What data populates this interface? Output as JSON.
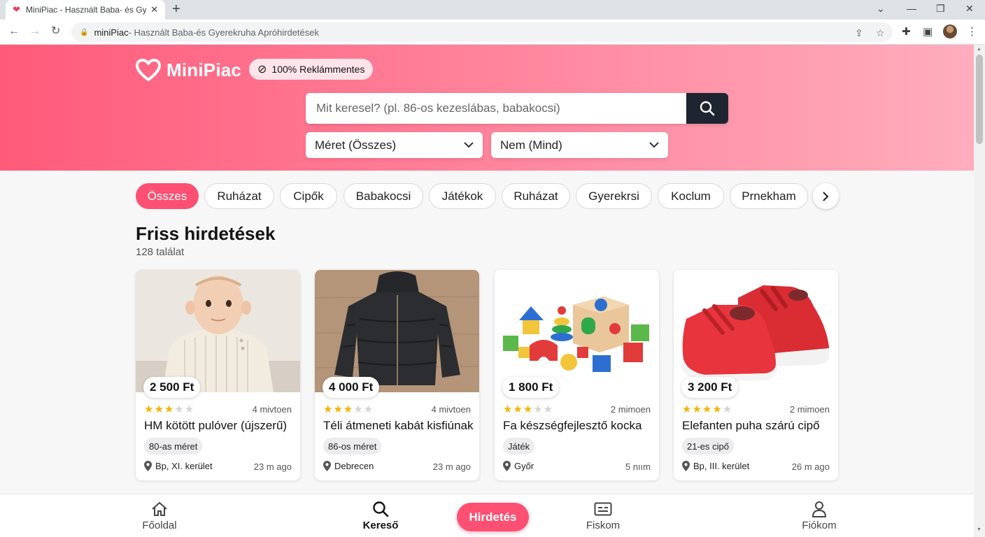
{
  "browser": {
    "tab_title": "MiniPiac - Használt Baba- és Gye",
    "url_host": "miniPiac",
    "url_rest": " - Használt Baba-és Gyerekruha Apróhirdetések"
  },
  "header": {
    "logo": "MiniPiac",
    "badge": "100% Reklámmentes",
    "search_placeholder": "Mit keresel? (pl. 86-os kezeslábas, babakocsi)",
    "size_select": "Méret (Összes)",
    "gender_select": "Nem (Mind)"
  },
  "categories": [
    "Összes",
    "Ruházat",
    "Cipők",
    "Babakocsi",
    "Játékok",
    "Ruházat",
    "Gyerekrsi",
    "Koclum",
    "Prnekham"
  ],
  "listing_section": {
    "title": "Friss hirdetések",
    "count": "128 találat"
  },
  "listings": [
    {
      "price": "2 500 Ft",
      "rating": 3,
      "posted": "4 mivtoen",
      "title": "HM kötött pulóver (újszerű)",
      "tag": "80-as méret",
      "location": "Bp, XI. kerület",
      "ago": "23 m ago",
      "image": "sweater-photo"
    },
    {
      "price": "4 000 Ft",
      "rating": 3,
      "posted": "4 mivtoen",
      "title": "Téli átmeneti kabát kisfiúnak",
      "tag": "86-os méret",
      "location": "Debrecen",
      "ago": "23 m ago",
      "image": "jacket-photo"
    },
    {
      "price": "1 800 Ft",
      "rating": 3,
      "posted": "2 mimoen",
      "title": "Fa készségfejlesztő kocka",
      "tag": "Játék",
      "location": "Győr",
      "ago": "5 nıım",
      "image": "toys-photo"
    },
    {
      "price": "3 200 Ft",
      "rating": 4,
      "posted": "2 mimoen",
      "title": "Elefanten puha szárú cipő",
      "tag": "21-es cipő",
      "location": "Bp, III. kerület",
      "ago": "26 m ago",
      "image": "shoes-photo"
    }
  ],
  "bottom_nav": {
    "home": "Főoldal",
    "search": "Kereső",
    "post": "Hirdetés",
    "listings": "Fiskom",
    "account": "Fiókom"
  },
  "colors": {
    "accent": "#ff4f72",
    "search_button": "#1e2530",
    "star": "#f5b400"
  }
}
